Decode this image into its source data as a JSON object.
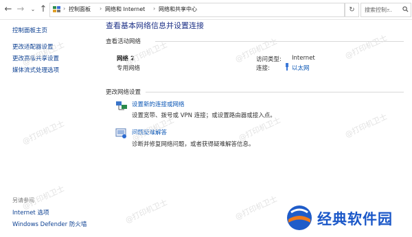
{
  "address_bar": {
    "breadcrumbs": [
      "控制面板",
      "网络和 Internet",
      "网络和共享中心"
    ],
    "search_placeholder": "搜索控制..."
  },
  "sidebar": {
    "items": [
      {
        "label": "控制面板主页"
      },
      {
        "label": "更改适配器设置"
      },
      {
        "label": "更改高级共享设置"
      },
      {
        "label": "媒体流式处理选项"
      }
    ],
    "see_also_heading": "另请参阅",
    "see_also": [
      {
        "label": "Internet 选项"
      },
      {
        "label": "Windows Defender 防火墙"
      }
    ]
  },
  "main": {
    "title": "查看基本网络信息并设置连接",
    "active_networks_heading": "查看活动网络",
    "network": {
      "name": "网络 2",
      "type": "专用网络",
      "access_type_label": "访问类型:",
      "access_type_value": "Internet",
      "connection_label": "连接:",
      "connection_value": "以太网"
    },
    "change_settings_heading": "更改网络设置",
    "tasks": [
      {
        "link": "设置新的连接或网络",
        "desc": "设置宽带、拨号或 VPN 连接；或设置路由器或接入点。"
      },
      {
        "link": "问题疑难解答",
        "desc": "诊断并修复网络问题，或者获得疑难解答信息。"
      }
    ]
  },
  "watermark": "@打印机卫士",
  "brand": {
    "text": "经典软件园"
  }
}
